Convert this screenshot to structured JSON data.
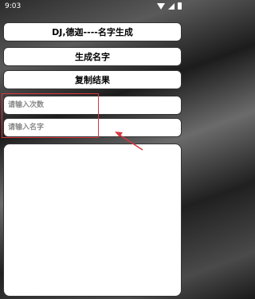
{
  "status_bar": {
    "time": "9:03",
    "icons": [
      "wifi-icon",
      "signal-icon",
      "battery-icon"
    ]
  },
  "buttons": {
    "title_label": "DJ,德迦----名字生成",
    "generate_label": "生成名字",
    "copy_label": "复制结果"
  },
  "inputs": {
    "count_placeholder": "请输入次数",
    "name_placeholder": "请输入名字"
  },
  "result": {
    "text": ""
  },
  "annotation": {
    "color": "#d9363e"
  }
}
